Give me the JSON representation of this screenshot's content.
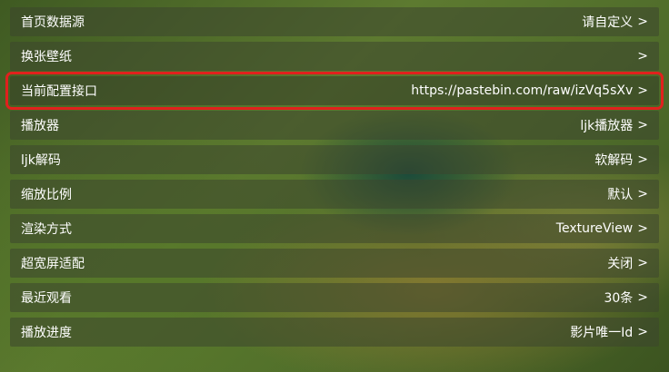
{
  "settings": {
    "items": [
      {
        "label": "首页数据源",
        "value": "请自定义",
        "chevron": ">"
      },
      {
        "label": "换张壁纸",
        "value": "",
        "chevron": ">"
      },
      {
        "label": "当前配置接口",
        "value": "https://pastebin.com/raw/izVq5sXv",
        "chevron": ">",
        "selected": true
      },
      {
        "label": "播放器",
        "value": "ljk播放器",
        "chevron": ">"
      },
      {
        "label": "ljk解码",
        "value": "软解码",
        "chevron": ">"
      },
      {
        "label": "缩放比例",
        "value": "默认",
        "chevron": ">"
      },
      {
        "label": "渲染方式",
        "value": "TextureView",
        "chevron": ">"
      },
      {
        "label": "超宽屏适配",
        "value": "关闭",
        "chevron": ">"
      },
      {
        "label": "最近观看",
        "value": "30条",
        "chevron": ">"
      },
      {
        "label": "播放进度",
        "value": "影片唯一Id",
        "chevron": ">"
      }
    ]
  },
  "colors": {
    "selection_outline": "#e0211d",
    "text": "#ffffff"
  }
}
